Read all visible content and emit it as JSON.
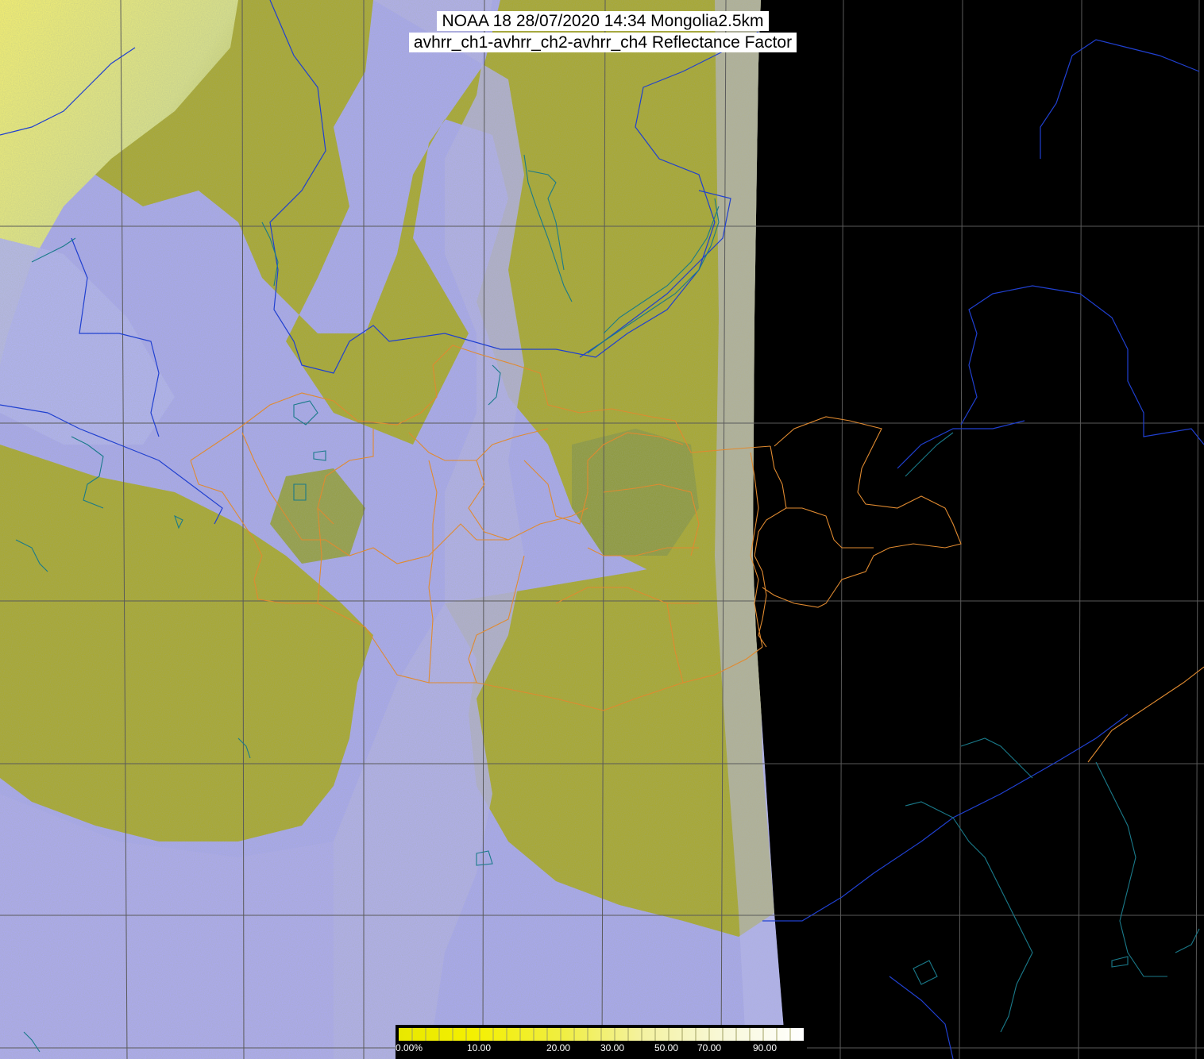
{
  "caption": {
    "line1": "NOAA 18 28/07/2020 14:34 Mongolia2.5km",
    "line2": "avhrr_ch1-avhrr_ch2-avhrr_ch4 Reflectance Factor"
  },
  "colorbar": {
    "ticks": [
      {
        "label": "0.00%",
        "value": 0
      },
      {
        "label": "10.00",
        "value": 10
      },
      {
        "label": "20.00",
        "value": 20
      },
      {
        "label": "30.00",
        "value": 30
      },
      {
        "label": "50.00",
        "value": 50
      },
      {
        "label": "70.00",
        "value": 70
      },
      {
        "label": "90.00",
        "value": 90
      }
    ]
  },
  "colors": {
    "background": "#000000",
    "olive": "#a8a830",
    "lavender": "#a8a8f0",
    "gridline": "#5a5a5a",
    "country_border": "#2040d0",
    "province_border": "#e08a30",
    "coast_cyan": "#1a7a8a"
  }
}
